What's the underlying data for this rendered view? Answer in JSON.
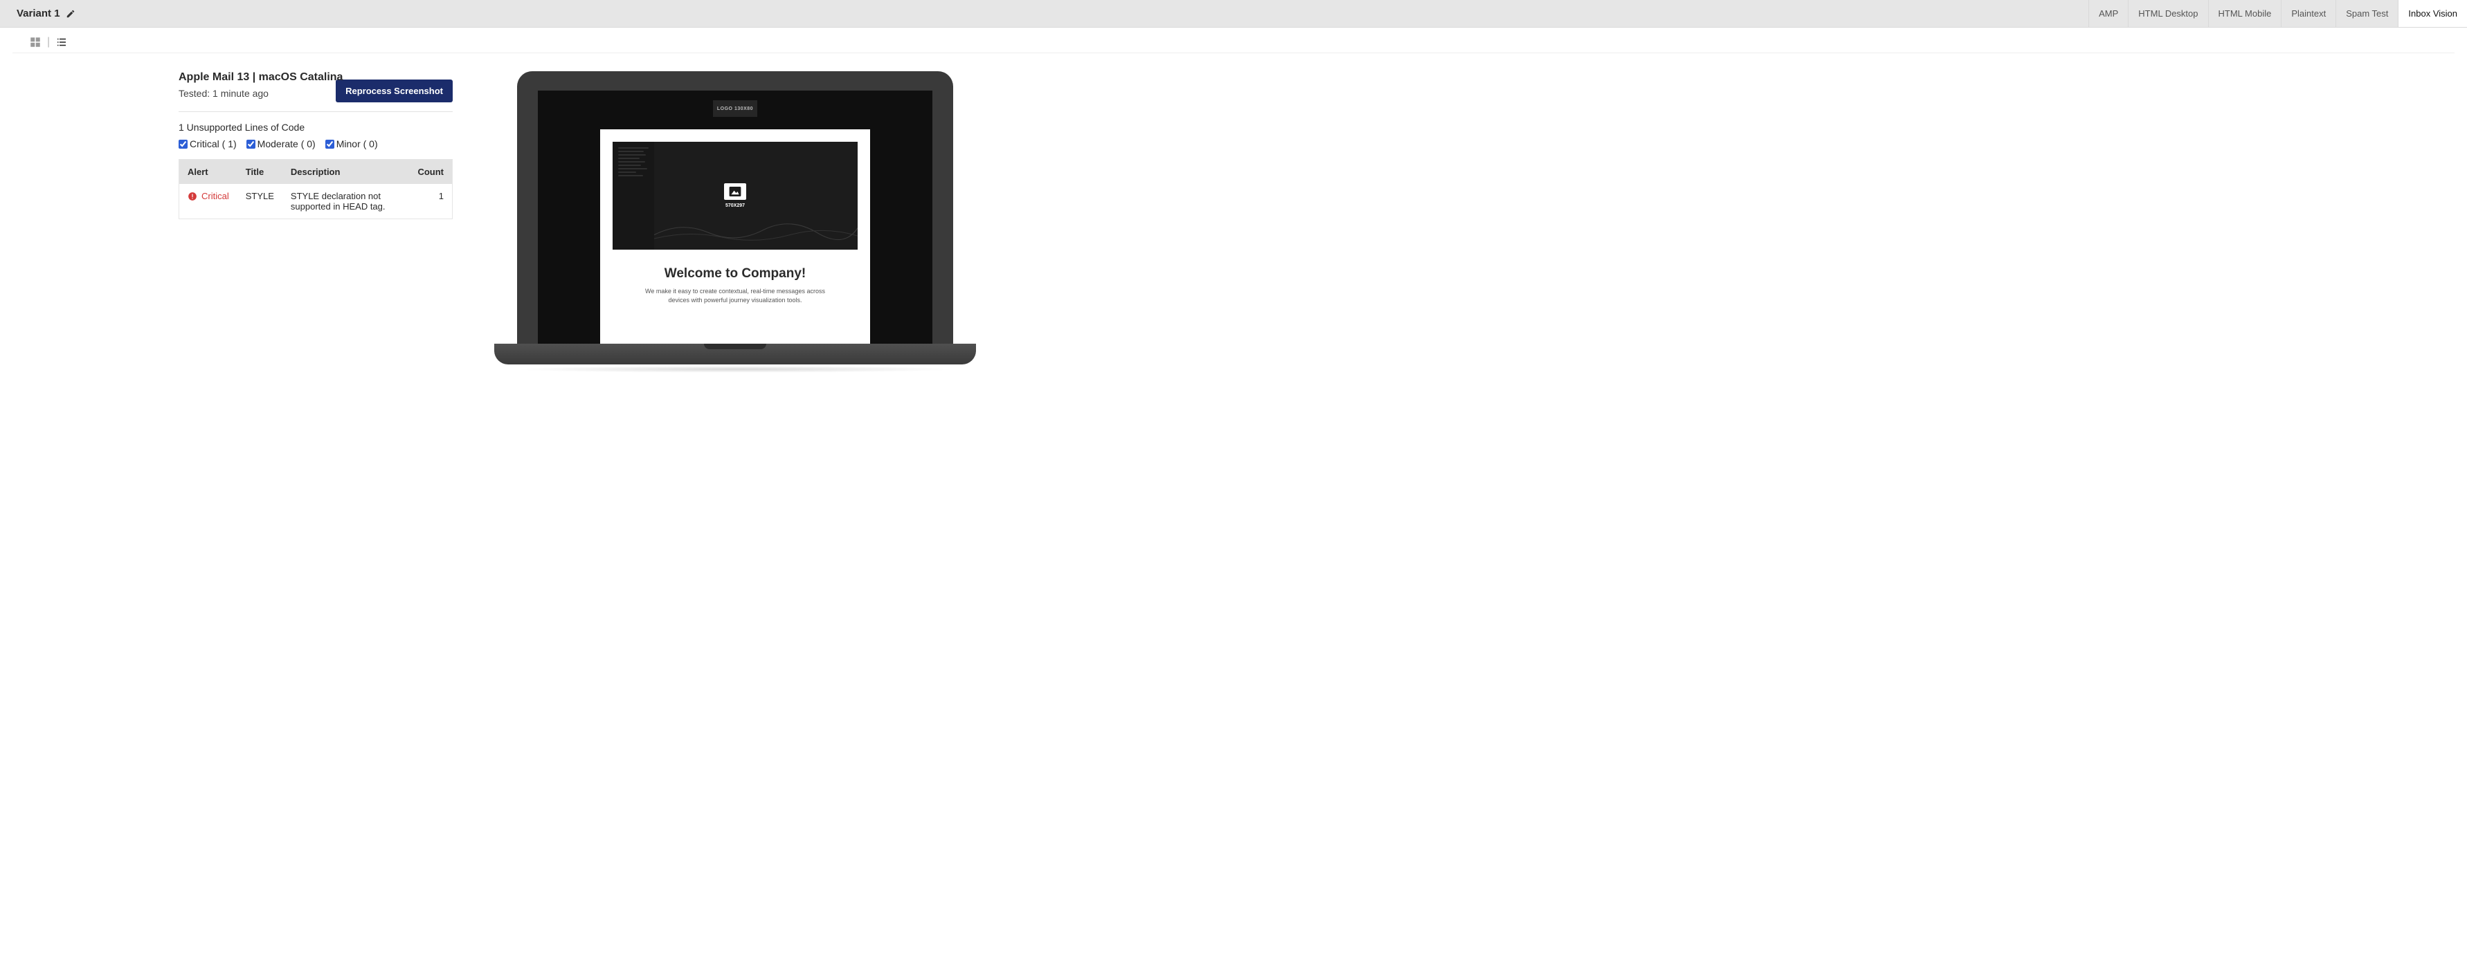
{
  "header": {
    "variant_label": "Variant 1",
    "tabs": [
      "AMP",
      "HTML Desktop",
      "HTML Mobile",
      "Plaintext",
      "Spam Test",
      "Inbox Vision"
    ],
    "active_tab": "Inbox Vision"
  },
  "detail": {
    "client_title": "Apple Mail 13 | macOS Catalina",
    "tested_text": "Tested: 1 minute ago",
    "reprocess_label": "Reprocess Screenshot",
    "unsupported_heading": "1 Unsupported Lines of Code",
    "filters": {
      "critical": "Critical ( 1)",
      "moderate": "Moderate ( 0)",
      "minor": "Minor ( 0)"
    },
    "table": {
      "headers": {
        "alert": "Alert",
        "title": "Title",
        "description": "Description",
        "count": "Count"
      },
      "rows": [
        {
          "alert": "Critical",
          "title": "STYLE",
          "description": "STYLE declaration not supported in HEAD tag.",
          "count": "1"
        }
      ]
    }
  },
  "preview": {
    "logo_text": "LOGO 130X80",
    "image_dim": "570X297",
    "welcome_heading": "Welcome to Company!",
    "welcome_body": "We make it easy to create contextual, real-time messages across devices with powerful journey visualization tools."
  }
}
